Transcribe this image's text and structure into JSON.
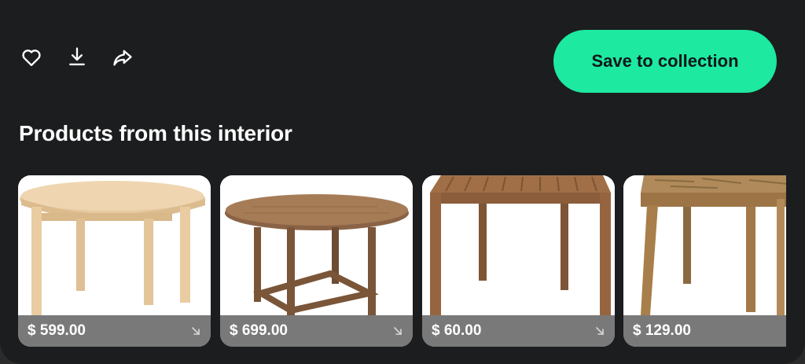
{
  "actions": {
    "like_icon": "heart-icon",
    "download_icon": "download-icon",
    "share_icon": "share-icon",
    "save_label": "Save to collection"
  },
  "section": {
    "title": "Products from this interior"
  },
  "products": [
    {
      "price": "$ 599.00",
      "image": "round-light-wood-table",
      "arrow_icon": "arrow-down-right-icon"
    },
    {
      "price": "$ 699.00",
      "image": "round-brown-wood-table-cross-base",
      "arrow_icon": "arrow-down-right-icon"
    },
    {
      "price": "$ 60.00",
      "image": "square-slatted-wood-table",
      "arrow_icon": "arrow-down-right-icon"
    },
    {
      "price": "$ 129.00",
      "image": "square-acacia-table",
      "arrow_icon": "arrow-down-right-icon"
    }
  ],
  "colors": {
    "panel_bg": "#1c1d1f",
    "accent": "#1de9a0",
    "price_bar": "#6e6e6e"
  }
}
